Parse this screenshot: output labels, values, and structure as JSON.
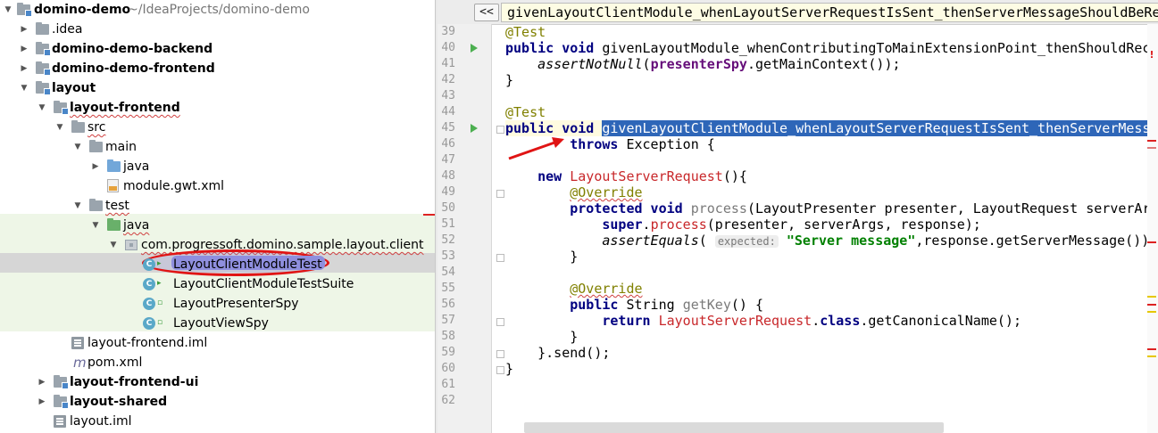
{
  "tree": {
    "root": {
      "label": "domino-demo",
      "path": "~/IdeaProjects/domino-demo"
    },
    "items": [
      {
        "label": ".idea"
      },
      {
        "label": "domino-demo-backend"
      },
      {
        "label": "domino-demo-frontend"
      },
      {
        "label": "layout"
      },
      {
        "label": "layout-frontend"
      },
      {
        "label": "src"
      },
      {
        "label": "main"
      },
      {
        "label": "java"
      },
      {
        "label": "module.gwt.xml"
      },
      {
        "label": "test"
      },
      {
        "label": "java"
      },
      {
        "label": "com.progressoft.domino.sample.layout.client"
      },
      {
        "label": "LayoutClientModuleTest"
      },
      {
        "label": "LayoutClientModuleTestSuite"
      },
      {
        "label": "LayoutPresenterSpy"
      },
      {
        "label": "LayoutViewSpy"
      },
      {
        "label": "layout-frontend.iml"
      },
      {
        "label": "pom.xml"
      },
      {
        "label": "layout-frontend-ui"
      },
      {
        "label": "layout-shared"
      },
      {
        "label": "layout.iml"
      }
    ],
    "class_icon_letter": "C",
    "maven_icon": "m",
    "highlight_color": "#e01414"
  },
  "editor": {
    "back_button": "<<",
    "method_breadcrumb": "givenLayoutClientModule_whenLayoutServerRequestIsSent_thenServerMessageShouldBeReceived",
    "line_numbers": [
      "39",
      "40",
      "41",
      "42",
      "43",
      "44",
      "45",
      "46",
      "47",
      "48",
      "49",
      "50",
      "51",
      "52",
      "53",
      "54",
      "55",
      "56",
      "57",
      "58",
      "59",
      "60",
      "61",
      "62"
    ],
    "code": {
      "l39": "@Test",
      "l40_kw": "public void ",
      "l40_name": "givenLayoutModule_whenContributingToMainExtensionPoint_thenShouldReceiveMainContext",
      "l40_tail": "() {",
      "l41_indent": "    ",
      "l41_call": "assertNotNull",
      "l41_open": "(",
      "l41_var": "presenterSpy",
      "l41_tail": ".getMainContext());",
      "l42": "}",
      "l44": "@Test",
      "l45_kw": "public void ",
      "l45_name": "givenLayoutClientModule_whenLayoutServerRequestIsSent_thenServerMessageShouldBeReceived",
      "l45_tail": "()",
      "l46_indent": "        ",
      "l46_kw": "throws",
      "l46_tail": " Exception {",
      "l48_indent": "    ",
      "l48_kw": "new ",
      "l48_class": "LayoutServerRequest",
      "l48_tail": "(){",
      "l49_indent": "        ",
      "l49_ann": "@Override",
      "l50_indent": "        ",
      "l50_kw": "protected void ",
      "l50_name": "process",
      "l50_tail": "(LayoutPresenter presenter, LayoutRequest serverArgs, LayoutResponse response) {",
      "l51_indent": "            ",
      "l51_kw": "super",
      "l51_dot": ".",
      "l51_call": "process",
      "l51_tail": "(presenter, serverArgs, response);",
      "l52_indent": "            ",
      "l52_call": "assertEquals",
      "l52_open": "( ",
      "l52_hint": "expected:",
      "l52_str": " \"Server message\"",
      "l52_tail": ",response.getServerMessage());",
      "l53_indent": "        ",
      "l53": "}",
      "l55_indent": "        ",
      "l55_ann": "@Override",
      "l56_indent": "        ",
      "l56_kw": "public ",
      "l56_type": "String ",
      "l56_name": "getKey",
      "l56_tail": "() {",
      "l57_indent": "            ",
      "l57_kw": "return ",
      "l57_class": "LayoutServerRequest",
      "l57_dot": ".",
      "l57_kw2": "class",
      "l57_tail": ".getCanonicalName();",
      "l58_indent": "        ",
      "l58": "}",
      "l59_indent": "    ",
      "l59": "}.send();",
      "l60": "}"
    },
    "error_marker": "!"
  },
  "colors": {
    "keyword": "#000080",
    "annotation": "#808000",
    "string": "#008000",
    "selection": "#2e66b8",
    "test_background": "#eef6e7",
    "arrow": "#e01414"
  }
}
